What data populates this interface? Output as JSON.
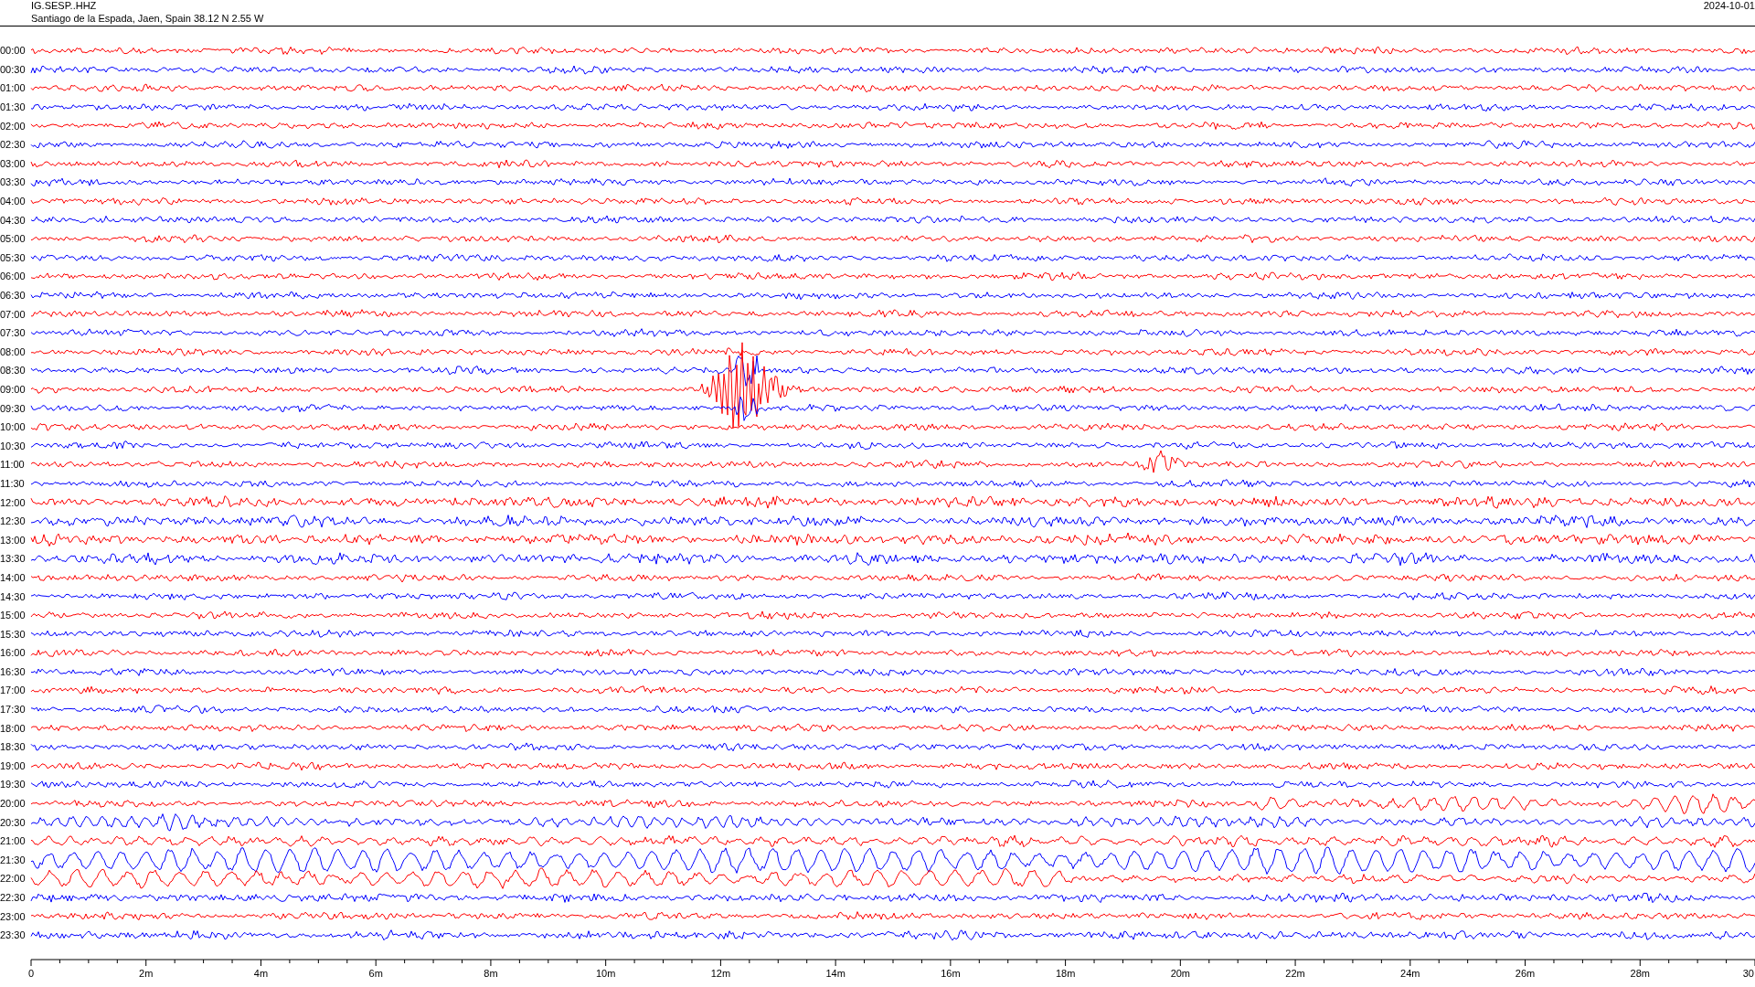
{
  "header": {
    "station": "IG.SESP..HHZ",
    "location": "Santiago de la Espada, Jaen, Spain  38.12 N 2.55 W",
    "date": "2024-10-01"
  },
  "rows": [
    {
      "time": "00:00",
      "color": "#ff0000"
    },
    {
      "time": "00:30",
      "color": "#0000ff"
    },
    {
      "time": "01:00",
      "color": "#ff0000"
    },
    {
      "time": "01:30",
      "color": "#0000ff"
    },
    {
      "time": "02:00",
      "color": "#ff0000"
    },
    {
      "time": "02:30",
      "color": "#0000ff"
    },
    {
      "time": "03:00",
      "color": "#ff0000"
    },
    {
      "time": "03:30",
      "color": "#0000ff"
    },
    {
      "time": "04:00",
      "color": "#ff0000"
    },
    {
      "time": "04:30",
      "color": "#0000ff"
    },
    {
      "time": "05:00",
      "color": "#ff0000"
    },
    {
      "time": "05:30",
      "color": "#0000ff"
    },
    {
      "time": "06:00",
      "color": "#ff0000"
    },
    {
      "time": "06:30",
      "color": "#0000ff"
    },
    {
      "time": "07:00",
      "color": "#ff0000"
    },
    {
      "time": "07:30",
      "color": "#0000ff"
    },
    {
      "time": "08:00",
      "color": "#ff0000"
    },
    {
      "time": "08:30",
      "color": "#0000ff"
    },
    {
      "time": "09:00",
      "color": "#ff0000"
    },
    {
      "time": "09:30",
      "color": "#0000ff"
    },
    {
      "time": "10:00",
      "color": "#ff0000"
    },
    {
      "time": "10:30",
      "color": "#0000ff"
    },
    {
      "time": "11:00",
      "color": "#ff0000"
    },
    {
      "time": "11:30",
      "color": "#0000ff"
    },
    {
      "time": "12:00",
      "color": "#ff0000"
    },
    {
      "time": "12:30",
      "color": "#0000ff"
    },
    {
      "time": "13:00",
      "color": "#ff0000"
    },
    {
      "time": "13:30",
      "color": "#0000ff"
    },
    {
      "time": "14:00",
      "color": "#ff0000"
    },
    {
      "time": "14:30",
      "color": "#0000ff"
    },
    {
      "time": "15:00",
      "color": "#ff0000"
    },
    {
      "time": "15:30",
      "color": "#0000ff"
    },
    {
      "time": "16:00",
      "color": "#ff0000"
    },
    {
      "time": "16:30",
      "color": "#0000ff"
    },
    {
      "time": "17:00",
      "color": "#ff0000"
    },
    {
      "time": "17:30",
      "color": "#0000ff"
    },
    {
      "time": "18:00",
      "color": "#ff0000"
    },
    {
      "time": "18:30",
      "color": "#0000ff"
    },
    {
      "time": "19:00",
      "color": "#ff0000"
    },
    {
      "time": "19:30",
      "color": "#0000ff"
    },
    {
      "time": "20:00",
      "color": "#ff0000"
    },
    {
      "time": "20:30",
      "color": "#0000ff"
    },
    {
      "time": "21:00",
      "color": "#ff0000"
    },
    {
      "time": "21:30",
      "color": "#0000ff"
    },
    {
      "time": "22:00",
      "color": "#ff0000"
    },
    {
      "time": "22:30",
      "color": "#0000ff"
    },
    {
      "time": "23:00",
      "color": "#ff0000"
    },
    {
      "time": "23:30",
      "color": "#0000ff"
    }
  ],
  "time_axis": {
    "labels": [
      "0",
      "2m",
      "4m",
      "6m",
      "8m",
      "10m",
      "12m",
      "14m",
      "16m",
      "18m",
      "20m",
      "22m",
      "24m",
      "26m",
      "28m",
      "30"
    ]
  }
}
